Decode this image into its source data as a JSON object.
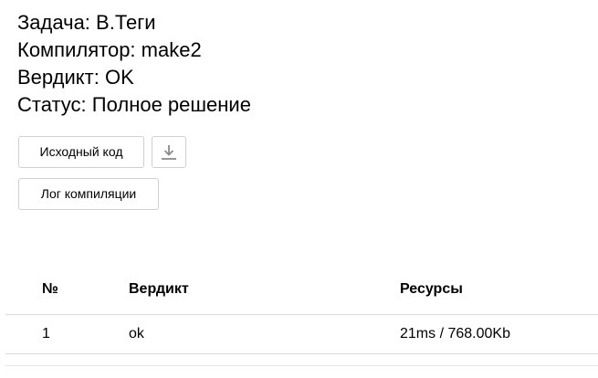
{
  "submission": {
    "task_label": "Задача:",
    "task_value": "В.Теги",
    "compiler_label": "Компилятор:",
    "compiler_value": "make2",
    "verdict_label": "Вердикт:",
    "verdict_value": "OK",
    "status_label": "Статус:",
    "status_value": "Полное решение"
  },
  "buttons": {
    "source_code": "Исходный код",
    "download_icon": "download-icon",
    "compile_log": "Лог компиляции"
  },
  "tests": {
    "headers": {
      "num": "№",
      "verdict": "Вердикт",
      "resources": "Ресурсы"
    },
    "rows": [
      {
        "num": "1",
        "verdict": "ok",
        "resources": "21ms / 768.00Kb"
      }
    ]
  }
}
